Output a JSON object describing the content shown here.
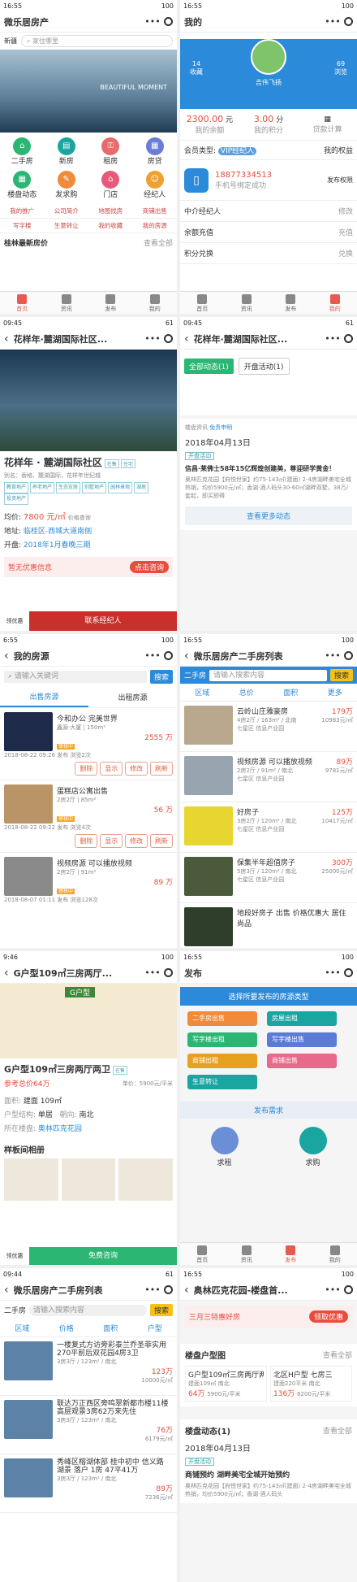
{
  "status": {
    "p1": "16:55",
    "p2": "16:55",
    "p3": "09:45",
    "p4": "09:45",
    "p5": "6:55",
    "p6": "16:55",
    "p7": "9:46",
    "p8": "16:55",
    "p9": "09:44",
    "p10": "16:55",
    "batt": "100",
    "batt2": "61"
  },
  "home": {
    "title": "微乐居房产",
    "city": "新疆",
    "search_placeholder": "家住哪里",
    "banner_text": "BEAUTIFUL MOMENT",
    "icons": [
      "二手房",
      "新房",
      "租房",
      "房贷",
      "楼盘动态",
      "发求购",
      "门店",
      "经纪人"
    ],
    "links": [
      [
        "我的推广",
        "公司简介",
        "地图找房",
        "商铺出售"
      ],
      [
        "写字楼",
        "生意转让",
        "我的收藏",
        "我的房源"
      ]
    ],
    "section": "桂林最新房价",
    "more": "查看全部"
  },
  "tabs": [
    "首页",
    "资讯",
    "发布",
    "我的"
  ],
  "mine": {
    "title": "我的",
    "favs": "14",
    "favs_label": "收藏",
    "name": "吉伟飞扬",
    "views": "69",
    "views_label": "浏览",
    "balance": "2300.00",
    "balance_unit": "元",
    "balance_label": "我的余额",
    "points": "3.00",
    "points_unit": "分",
    "points_label": "我的积分",
    "loan": "贷款计算",
    "member_label": "会员类型:",
    "member": "VIP经纪人",
    "rights": "我的权益",
    "phone": "18877334513",
    "phone_note": "手机号绑定成功",
    "publish": "发布权限",
    "menu": [
      [
        "中介经纪人",
        "修改"
      ],
      [
        "余额充值",
        "充值"
      ],
      [
        "积分兑换",
        "兑换"
      ]
    ]
  },
  "estate": {
    "title": "花样年·麓湖国际社区...",
    "name": "花样年 · 麓湖国际社区",
    "status": "在售",
    "type": "住宅",
    "alias": "别名：香格、麓湖国际，花样年世纪城",
    "tags": [
      "教育地产",
      "养老地产",
      "生态宜居",
      "别墅地产",
      "园林景观",
      "湖居",
      "投资地产"
    ],
    "price_label": "均价:",
    "price": "7800 元/㎡",
    "price_note": "价格查询",
    "addr_label": "地址:",
    "addr": "临桂区-西城大道南侧",
    "open_label": "开盘:",
    "open": "2018年1月春晚三期",
    "promo": "暂无优惠信息",
    "promo_btn": "点击咨询",
    "bottom_left": "联系经纪人",
    "bottom_icon": "领优惠"
  },
  "news": {
    "title": "花样年·麓湖国际社区...",
    "tab1": "全部动态(1)",
    "tab2": "开盘活动(1)",
    "label": "楼盘资讯",
    "sub": "免责申明",
    "date": "2018年04月13日",
    "tag": "开盘活动",
    "head": "信昌·莱佛士58年15亿辉煌创建美，尊迎研学黄金！",
    "body": "奥林匹克花园【府悦世家】约75-143㎡(建面) 2-4房湖畔美宅全城热销，均价5900元/㎡；香湖·酒人码头30-60㎡湖畔双墅，38万/套起，即买即得",
    "more": "查看更多动态"
  },
  "myhouse": {
    "title": "我的房源",
    "search_placeholder": "请输入关键词",
    "search_btn": "搜索",
    "tab1": "出售房源",
    "tab2": "出租房源",
    "items": [
      {
        "title": "今和办公 完美世界",
        "sub": "鑫源·大厦 | 150m²",
        "price": "2555 万",
        "status": "审核中",
        "date": "2018-08-22 09:26 发布 浏览2次"
      },
      {
        "title": "蛋糕店公寓出售",
        "sub": "2房2厅 | 85m²",
        "price": "56 万",
        "status": "审核中",
        "date": "2018-08-22 09:22 发布 浏览4次"
      },
      {
        "title": "视频房源 可以播放视频",
        "sub": "2房2厅 | 91m²",
        "price": "89 万",
        "status": "审核中",
        "date": "2018-08-07 01:11 发布 浏览128次"
      }
    ],
    "ops": [
      "删除",
      "显示",
      "修改",
      "刷新"
    ]
  },
  "list1": {
    "title": "微乐居房产二手房列表",
    "type": "二手房",
    "search_placeholder": "请输入搜索内容",
    "search_btn": "搜索",
    "filters": [
      "区域",
      "总价",
      "面积",
      "更多"
    ],
    "items": [
      {
        "title": "云岭山庄雅豪房",
        "sub": "4房2厅 / 163m² / 北南",
        "area": "七星区 信息产业园",
        "price": "179万",
        "unit": "10983元/㎡"
      },
      {
        "title": "视频房源 可以播放视频",
        "sub": "2房2厅 / 91m² / 南北",
        "area": "七星区 信息产业园",
        "price": "89万",
        "unit": "9781元/㎡"
      },
      {
        "title": "好房子",
        "sub": "3房2厅 / 120m² / 南北",
        "area": "七星区 信息产业园",
        "price": "125万",
        "unit": "10417元/㎡"
      },
      {
        "title": "保集半年超值房子",
        "sub": "5房3厅 / 120m² / 南北",
        "area": "七星区 信息产业园",
        "price": "300万",
        "unit": "25000元/㎡"
      },
      {
        "title": "地段好房子 出售 价格优惠大 居住尚品",
        "sub": "",
        "area": "",
        "price": "",
        "unit": ""
      }
    ]
  },
  "gp": {
    "title": "G户型109㎡三房两厅...",
    "name": "G户型109㎡三房两厅两卫",
    "status": "在售",
    "price": "参考总价64万",
    "unit": "单价：5900元/平米",
    "plan": "G户型",
    "area_label": "面积:",
    "area": "建面 109㎡",
    "room_label": "户型结构:",
    "room": "单居",
    "face_label": "朝向:",
    "face": "南北",
    "estate_label": "所在楼盘:",
    "estate": "奥林匹克花园",
    "gallery": "样板间相册",
    "bottom": "免费咨询",
    "left": "领优惠"
  },
  "publish": {
    "title": "发布",
    "head": "选择所要发布的房源类型",
    "btns": [
      "二手房出售",
      "房屋出租",
      "写字楼出租",
      "写字楼出售",
      "商铺出租",
      "商铺出售",
      "生意转让"
    ],
    "need": "发布需求",
    "rent": "求租",
    "buy": "求购"
  },
  "list2": {
    "title": "微乐居房产二手房列表",
    "type": "二手房",
    "search_placeholder": "请输入搜索内容",
    "search_btn": "搜索",
    "filters": [
      "区域",
      "价格",
      "面积",
      "户型"
    ],
    "items": [
      {
        "title": "一楼复式方访旁彩泰兰乔圣菲实用270平前后双花园4房3卫",
        "sub": "3房3厅 / 123m² / 南北",
        "price": "123万",
        "unit": "10000元/㎡"
      },
      {
        "title": "联达万正西区旁鸣翠新都市楼11楼高层观景3房62万来先住",
        "sub": "3房3厅 / 123m² / 南北",
        "price": "76万",
        "unit": "6179元/㎡"
      },
      {
        "title": "秀峰区榕湖体部 桂中初中 信义路 湖景 落户 1房 47平41万",
        "sub": "3房3厅 / 123m² / 南北",
        "price": "89万",
        "unit": "7236元/㎡"
      }
    ]
  },
  "olym": {
    "title": "奥林匹克花园-楼盘首...",
    "promo": "三月三特惠好房",
    "promo_btn": "领取优惠",
    "types": "楼盘户型图",
    "more": "查看全部",
    "card1": {
      "name": "G户型109㎡三房两厅两卫",
      "sub": "建面109㎡ 南北",
      "price": "64万",
      "unit": "5900元/平米"
    },
    "card2": {
      "name": "北区H户型 七房三",
      "sub": "建面220平米 南北",
      "price": "136万",
      "unit": "6200元/平米"
    },
    "dyn": "楼盘动态(1)",
    "date": "2018年04月13日",
    "tag": "开盘活动",
    "head": "商铺预约 湖畔美宅全城开始预约",
    "body": "奥林匹克花园【府悦世家】约75-143㎡(建面) 2-4房湖畔美宅全城热销，均价5900元/㎡；香湖·酒人码头"
  }
}
